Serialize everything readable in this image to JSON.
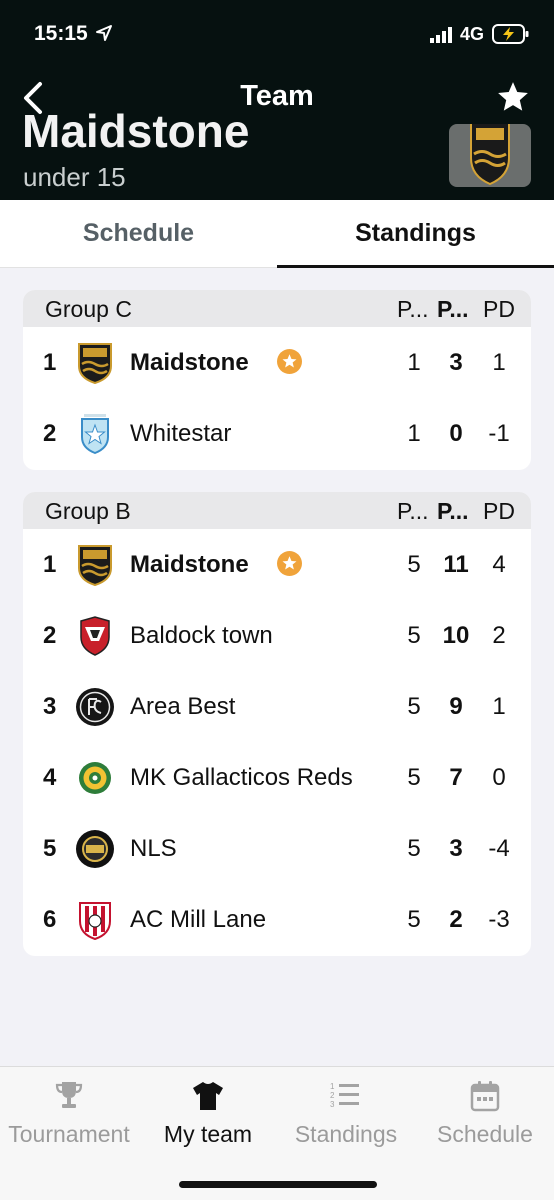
{
  "status": {
    "time": "15:15",
    "network": "4G"
  },
  "nav": {
    "title": "Team"
  },
  "team": {
    "name": "Maidstone",
    "subtitle": "under 15"
  },
  "tabs": [
    {
      "label": "Schedule",
      "active": false
    },
    {
      "label": "Standings",
      "active": true
    }
  ],
  "groups": [
    {
      "name": "Group C",
      "headers": [
        "P...",
        "P...",
        "PD"
      ],
      "rows": [
        {
          "rank": "1",
          "team": "Maidstone",
          "played": "1",
          "points": "3",
          "pd": "1",
          "own_team": true
        },
        {
          "rank": "2",
          "team": "Whitestar",
          "played": "1",
          "points": "0",
          "pd": "-1",
          "own_team": false
        }
      ]
    },
    {
      "name": "Group B",
      "headers": [
        "P...",
        "P...",
        "PD"
      ],
      "rows": [
        {
          "rank": "1",
          "team": "Maidstone",
          "played": "5",
          "points": "11",
          "pd": "4",
          "own_team": true
        },
        {
          "rank": "2",
          "team": "Baldock town",
          "played": "5",
          "points": "10",
          "pd": "2",
          "own_team": false
        },
        {
          "rank": "3",
          "team": "Area Best",
          "played": "5",
          "points": "9",
          "pd": "1",
          "own_team": false
        },
        {
          "rank": "4",
          "team": "MK Gallacticos Reds",
          "played": "5",
          "points": "7",
          "pd": "0",
          "own_team": false
        },
        {
          "rank": "5",
          "team": "NLS",
          "played": "5",
          "points": "3",
          "pd": "-4",
          "own_team": false
        },
        {
          "rank": "6",
          "team": "AC Mill Lane",
          "played": "5",
          "points": "2",
          "pd": "-3",
          "own_team": false
        }
      ]
    }
  ],
  "bottom_nav": [
    {
      "label": "Tournament",
      "icon": "trophy-icon",
      "active": false
    },
    {
      "label": "My team",
      "icon": "shirt-icon",
      "active": true
    },
    {
      "label": "Standings",
      "icon": "numbered-list-icon",
      "active": false
    },
    {
      "label": "Schedule",
      "icon": "calendar-icon",
      "active": false
    }
  ],
  "colors": {
    "header_bg": "#061110",
    "favorite_badge": "#f0a33a",
    "active_text": "#111111",
    "inactive_text": "#9b9b9b"
  }
}
